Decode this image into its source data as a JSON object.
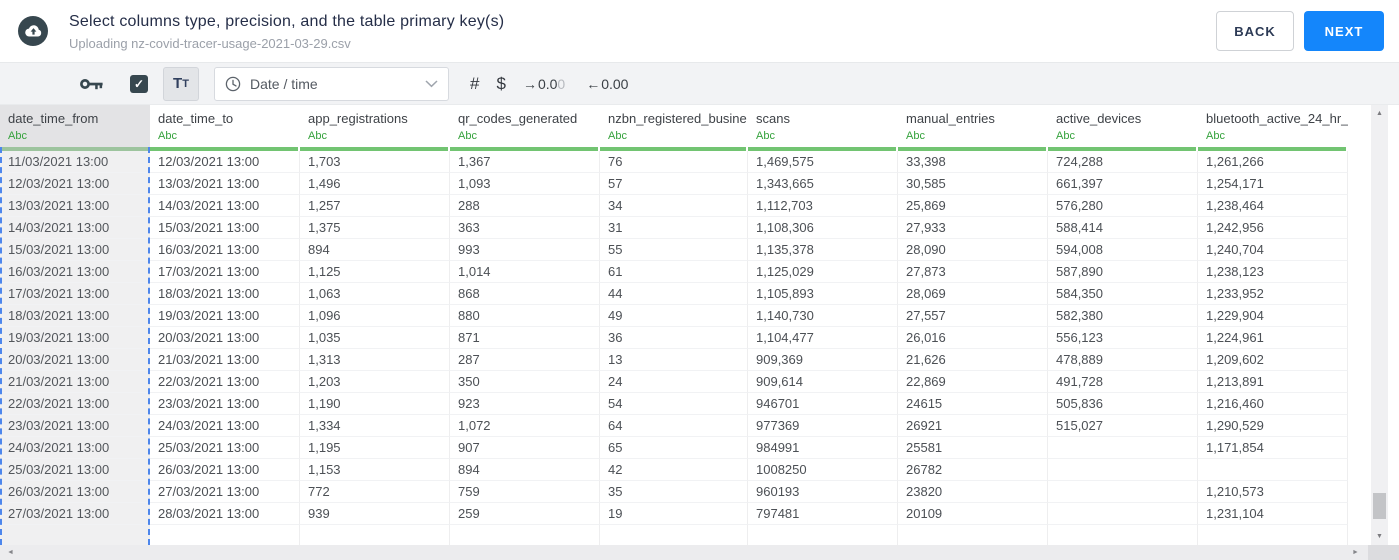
{
  "header": {
    "title": "Select columns type, precision, and the table primary key(s)",
    "subtitle": "Uploading nz-covid-tracer-usage-2021-03-29.csv",
    "back_label": "BACK",
    "next_label": "NEXT"
  },
  "toolbar": {
    "checkbox_checked": true,
    "checkbox_glyph": "✓",
    "text_type_large": "T",
    "text_type_small": "T",
    "type_select_value": "Date / time",
    "number_label": "#",
    "currency_label": "$",
    "increase_decimal": {
      "arrow": "→",
      "dark": "0.0",
      "faded": "0"
    },
    "decrease_decimal": {
      "arrow": "←",
      "dark": "0.00"
    }
  },
  "table": {
    "columns": [
      {
        "name": "date_time_from",
        "type_label": "Abc",
        "selected": true
      },
      {
        "name": "date_time_to",
        "type_label": "Abc",
        "selected": false
      },
      {
        "name": "app_registrations",
        "type_label": "Abc",
        "selected": false
      },
      {
        "name": "qr_codes_generated",
        "type_label": "Abc",
        "selected": false
      },
      {
        "name": "nzbn_registered_busine",
        "type_label": "Abc",
        "selected": false
      },
      {
        "name": "scans",
        "type_label": "Abc",
        "selected": false
      },
      {
        "name": "manual_entries",
        "type_label": "Abc",
        "selected": false
      },
      {
        "name": "active_devices",
        "type_label": "Abc",
        "selected": false
      },
      {
        "name": "bluetooth_active_24_hr_",
        "type_label": "Abc",
        "selected": false
      }
    ],
    "rows": [
      [
        "11/03/2021 13:00",
        "12/03/2021 13:00",
        "1,703",
        "1,367",
        "76",
        "1,469,575",
        "33,398",
        "724,288",
        "1,261,266"
      ],
      [
        "12/03/2021 13:00",
        "13/03/2021 13:00",
        "1,496",
        "1,093",
        "57",
        "1,343,665",
        "30,585",
        "661,397",
        "1,254,171"
      ],
      [
        "13/03/2021 13:00",
        "14/03/2021 13:00",
        "1,257",
        "288",
        "34",
        "1,112,703",
        "25,869",
        "576,280",
        "1,238,464"
      ],
      [
        "14/03/2021 13:00",
        "15/03/2021 13:00",
        "1,375",
        "363",
        "31",
        "1,108,306",
        "27,933",
        "588,414",
        "1,242,956"
      ],
      [
        "15/03/2021 13:00",
        "16/03/2021 13:00",
        "894",
        "993",
        "55",
        "1,135,378",
        "28,090",
        "594,008",
        "1,240,704"
      ],
      [
        "16/03/2021 13:00",
        "17/03/2021 13:00",
        "1,125",
        "1,014",
        "61",
        "1,125,029",
        "27,873",
        "587,890",
        "1,238,123"
      ],
      [
        "17/03/2021 13:00",
        "18/03/2021 13:00",
        "1,063",
        "868",
        "44",
        "1,105,893",
        "28,069",
        "584,350",
        "1,233,952"
      ],
      [
        "18/03/2021 13:00",
        "19/03/2021 13:00",
        "1,096",
        "880",
        "49",
        "1,140,730",
        "27,557",
        "582,380",
        "1,229,904"
      ],
      [
        "19/03/2021 13:00",
        "20/03/2021 13:00",
        "1,035",
        "871",
        "36",
        "1,104,477",
        "26,016",
        "556,123",
        "1,224,961"
      ],
      [
        "20/03/2021 13:00",
        "21/03/2021 13:00",
        "1,313",
        "287",
        "13",
        "909,369",
        "21,626",
        "478,889",
        "1,209,602"
      ],
      [
        "21/03/2021 13:00",
        "22/03/2021 13:00",
        "1,203",
        "350",
        "24",
        "909,614",
        "22,869",
        "491,728",
        "1,213,891"
      ],
      [
        "22/03/2021 13:00",
        "23/03/2021 13:00",
        "1,190",
        "923",
        "54",
        "946701",
        "24615",
        "505,836",
        "1,216,460"
      ],
      [
        "23/03/2021 13:00",
        "24/03/2021 13:00",
        "1,334",
        "1,072",
        "64",
        "977369",
        "26921",
        "515,027",
        "1,290,529"
      ],
      [
        "24/03/2021 13:00",
        "25/03/2021 13:00",
        "1,195",
        "907",
        "65",
        "984991",
        "25581",
        "",
        "1,171,854"
      ],
      [
        "25/03/2021 13:00",
        "26/03/2021 13:00",
        "1,153",
        "894",
        "42",
        "1008250",
        "26782",
        "",
        ""
      ],
      [
        "26/03/2021 13:00",
        "27/03/2021 13:00",
        "772",
        "759",
        "35",
        "960193",
        "23820",
        "",
        "1,210,573"
      ],
      [
        "27/03/2021 13:00",
        "28/03/2021 13:00",
        "939",
        "259",
        "19",
        "797481",
        "20109",
        "",
        "1,231,104"
      ]
    ]
  },
  "scrollbar": {
    "up": "▲",
    "down": "▼",
    "left": "◄",
    "right": "►"
  },
  "colors": {
    "accent_blue": "#1486fb",
    "icon_dark": "#37474f",
    "green_text": "#35a23c",
    "green_bar": "#72c472",
    "selection_blue": "#4d86ec"
  }
}
